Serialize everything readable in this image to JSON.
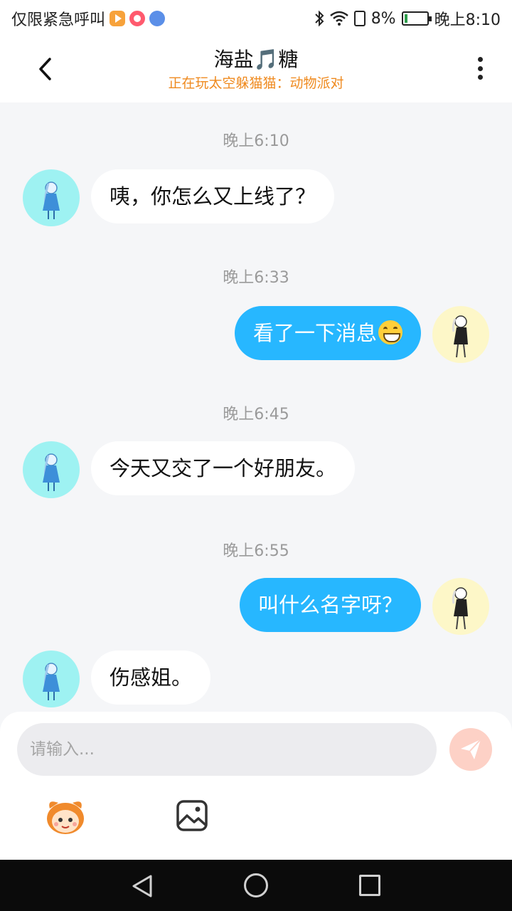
{
  "status_bar": {
    "carrier_text": "仅限紧急呼叫",
    "battery_percent": "8%",
    "battery_level": 0.08,
    "time": "晚上8:10",
    "icons": [
      "video-app-icon",
      "record-app-icon",
      "browser-app-icon",
      "bluetooth-icon",
      "wifi-icon",
      "sim-icon",
      "battery-icon"
    ]
  },
  "header": {
    "title": "海盐🎵糖",
    "subtitle": "正在玩太空躲猫猫：动物派对"
  },
  "messages": [
    {
      "timestamp": "晚上6:10",
      "side": "in",
      "text": "咦，你怎么又上线了？"
    },
    {
      "timestamp": "晚上6:33",
      "side": "out",
      "text": "看了一下消息",
      "emoji": "grinning-face-emoji"
    },
    {
      "timestamp": "晚上6:45",
      "side": "in",
      "text": "今天又交了一个好朋友。"
    },
    {
      "timestamp": "晚上6:55",
      "side": "out",
      "text": "叫什么名字呀？"
    },
    {
      "timestamp": "",
      "side": "in",
      "text": "伤感姐。"
    }
  ],
  "input": {
    "placeholder": "请输入..."
  },
  "colors": {
    "accent_blue": "#27b7ff",
    "subtitle_orange": "#ef8a1f",
    "send_button": "#fdd1c6",
    "background": "#f5f6f8"
  }
}
